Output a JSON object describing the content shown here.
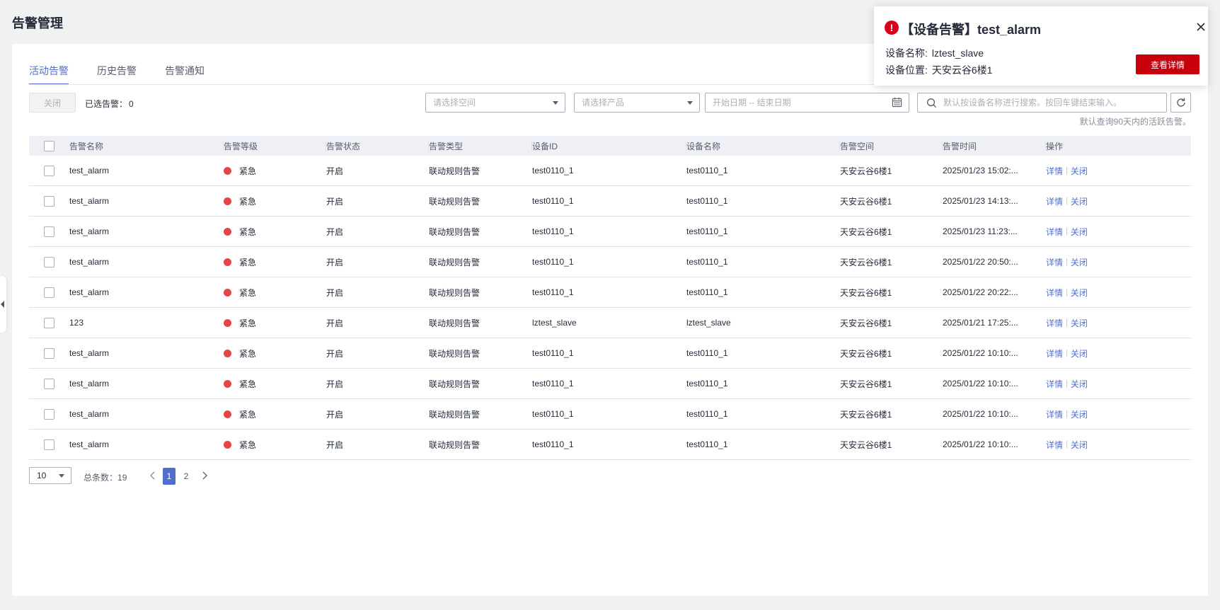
{
  "page": {
    "title": "告警管理"
  },
  "tabs": [
    {
      "label": "活动告警",
      "active": true
    },
    {
      "label": "历史告警",
      "active": false
    },
    {
      "label": "告警通知",
      "active": false
    }
  ],
  "toolbar": {
    "close_label": "关闭",
    "selected_label": "已选告警：",
    "selected_count": "0",
    "space_placeholder": "请选择空间",
    "product_placeholder": "请选择产品",
    "date_placeholder": "开始日期 -- 结束日期",
    "search_placeholder": "默认按设备名称进行搜索。按回车键结束输入。",
    "hint": "默认查询90天内的活跃告警。"
  },
  "table": {
    "headers": [
      "告警名称",
      "告警等级",
      "告警状态",
      "告警类型",
      "设备ID",
      "设备名称",
      "告警空间",
      "告警时间",
      "操作"
    ],
    "op_detail": "详情",
    "op_close": "关闭",
    "op_sep": "|",
    "rows": [
      {
        "name": "test_alarm",
        "level": "紧急",
        "status": "开启",
        "type": "联动规则告警",
        "device_id": "test0110_1",
        "device_name": "test0110_1",
        "space": "天安云谷6楼1",
        "time": "2025/01/23 15:02:..."
      },
      {
        "name": "test_alarm",
        "level": "紧急",
        "status": "开启",
        "type": "联动规则告警",
        "device_id": "test0110_1",
        "device_name": "test0110_1",
        "space": "天安云谷6楼1",
        "time": "2025/01/23 14:13:..."
      },
      {
        "name": "test_alarm",
        "level": "紧急",
        "status": "开启",
        "type": "联动规则告警",
        "device_id": "test0110_1",
        "device_name": "test0110_1",
        "space": "天安云谷6楼1",
        "time": "2025/01/23 11:23:..."
      },
      {
        "name": "test_alarm",
        "level": "紧急",
        "status": "开启",
        "type": "联动规则告警",
        "device_id": "test0110_1",
        "device_name": "test0110_1",
        "space": "天安云谷6楼1",
        "time": "2025/01/22 20:50:..."
      },
      {
        "name": "test_alarm",
        "level": "紧急",
        "status": "开启",
        "type": "联动规则告警",
        "device_id": "test0110_1",
        "device_name": "test0110_1",
        "space": "天安云谷6楼1",
        "time": "2025/01/22 20:22:..."
      },
      {
        "name": "123",
        "level": "紧急",
        "status": "开启",
        "type": "联动规则告警",
        "device_id": "lztest_slave",
        "device_name": "lztest_slave",
        "space": "天安云谷6楼1",
        "time": "2025/01/21 17:25:..."
      },
      {
        "name": "test_alarm",
        "level": "紧急",
        "status": "开启",
        "type": "联动规则告警",
        "device_id": "test0110_1",
        "device_name": "test0110_1",
        "space": "天安云谷6楼1",
        "time": "2025/01/22 10:10:..."
      },
      {
        "name": "test_alarm",
        "level": "紧急",
        "status": "开启",
        "type": "联动规则告警",
        "device_id": "test0110_1",
        "device_name": "test0110_1",
        "space": "天安云谷6楼1",
        "time": "2025/01/22 10:10:..."
      },
      {
        "name": "test_alarm",
        "level": "紧急",
        "status": "开启",
        "type": "联动规则告警",
        "device_id": "test0110_1",
        "device_name": "test0110_1",
        "space": "天安云谷6楼1",
        "time": "2025/01/22 10:10:..."
      },
      {
        "name": "test_alarm",
        "level": "紧急",
        "status": "开启",
        "type": "联动规则告警",
        "device_id": "test0110_1",
        "device_name": "test0110_1",
        "space": "天安云谷6楼1",
        "time": "2025/01/22 10:10:..."
      }
    ]
  },
  "pagination": {
    "page_size": "10",
    "total_label": "总条数：",
    "total": "19",
    "pages": [
      "1",
      "2"
    ],
    "current": "1"
  },
  "notification": {
    "icon": "!",
    "title": "【设备告警】test_alarm",
    "device_name_label": "设备名称:",
    "device_name": "lztest_slave",
    "device_location_label": "设备位置:",
    "device_location": "天安云谷6楼1",
    "button_label": "查看详情"
  },
  "colors": {
    "accent": "#526ecc",
    "danger": "#c7000b",
    "level_urgent": "#e54545"
  }
}
